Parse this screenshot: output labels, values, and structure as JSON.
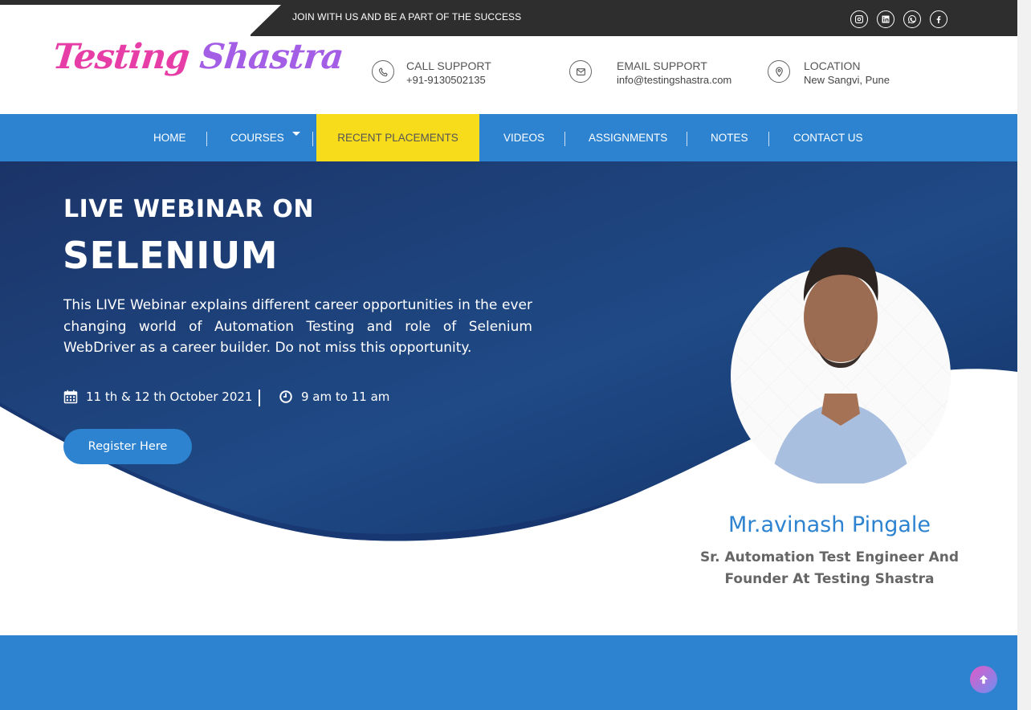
{
  "topbar": {
    "tagline": "JOIN WITH US AND BE A PART OF THE SUCCESS",
    "socials": [
      "instagram-icon",
      "linkedin-icon",
      "whatsapp-icon",
      "facebook-icon"
    ]
  },
  "logo": {
    "part1": "Testing ",
    "part2": "Shastra"
  },
  "contacts": [
    {
      "title": "CALL SUPPORT",
      "value": "+91-9130502135",
      "icon": "phone-icon"
    },
    {
      "title": "EMAIL SUPPORT",
      "value": "info@testingshastra.com",
      "icon": "envelope-icon"
    },
    {
      "title": "LOCATION",
      "value": "New Sangvi, Pune",
      "icon": "map-marker-icon"
    }
  ],
  "nav": {
    "items": [
      "HOME",
      "COURSES",
      "RECENT PLACEMENTS",
      "VIDEOS",
      "ASSIGNMENTS",
      "NOTES",
      "CONTACT US"
    ],
    "active": "RECENT PLACEMENTS"
  },
  "hero": {
    "line1": "LIVE WEBINAR ON",
    "line2": "SELENIUM",
    "description": "This LIVE Webinar explains different career opportunities in the ever changing world of Automation Testing and role of Selenium WebDriver as a career builder. Do not miss this opportunity.",
    "date": "11 th & 12 th October 2021",
    "time": "9 am to 11 am",
    "register_label": "Register Here"
  },
  "speaker": {
    "name": "Mr.avinash Pingale",
    "role": "Sr. Automation Test Engineer And Founder At Testing Shastra"
  },
  "colors": {
    "accent": "#2e83d0",
    "active_nav": "#f7dc1b",
    "hero_dark": "#1c3b73",
    "topbar": "#2e2e2e"
  }
}
